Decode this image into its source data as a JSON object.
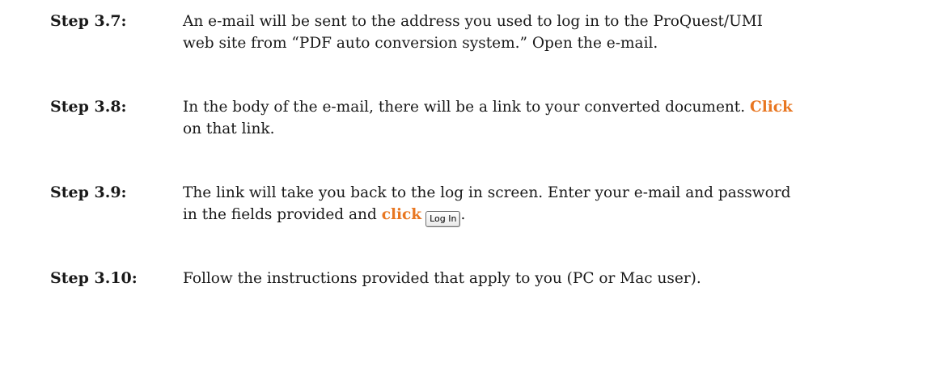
{
  "steps": [
    {
      "label": "Step 3.7:",
      "line1": "An e-mail will be sent to the address you used to log in to the ProQuest/UMI",
      "line2": "web site from “PDF auto conversion system.” Open the e-mail."
    },
    {
      "label": "Step 3.8:",
      "line1_pre": "In the body of the e-mail, there will be a link to your converted document. ",
      "keyword": "Click",
      "line2": "on that link."
    },
    {
      "label": "Step 3.9:",
      "line1": "The link will take you back to the log in screen. Enter your e-mail and password",
      "line2_pre": "in the fields provided and ",
      "keyword": "click",
      "button_label": "Log In",
      "line2_post": "."
    },
    {
      "label": "Step 3.10:",
      "line1": "Follow the instructions provided that apply to you (PC or Mac user)."
    }
  ],
  "colors": {
    "keyword": "#e87722",
    "text": "#1a1a1a"
  }
}
